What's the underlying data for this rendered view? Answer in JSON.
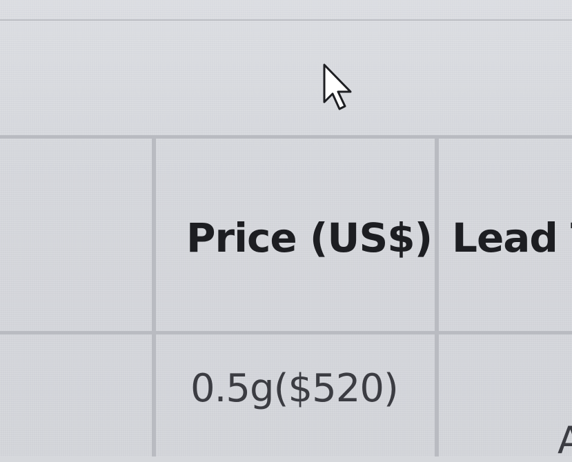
{
  "table": {
    "columns": [
      {
        "header": "Price (US$)"
      },
      {
        "header": "Lead T"
      }
    ],
    "rows": [
      {
        "price": "0.5g($520)",
        "lead_partial": "A"
      }
    ]
  },
  "cursor": {
    "icon": "arrow-cursor-icon"
  },
  "colors": {
    "background": "#d6d8dc",
    "grid": "#b9bbc1",
    "text": "#1d1e22"
  }
}
